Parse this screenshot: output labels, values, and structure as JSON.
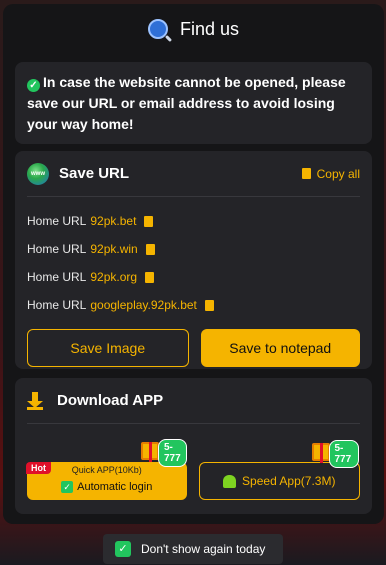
{
  "header": {
    "title": "Find us"
  },
  "notice": {
    "text": "In case the website cannot be opened, please save our URL or email address to avoid losing your way home!"
  },
  "save_url": {
    "title": "Save URL",
    "copy_all": "Copy all",
    "prefix": "Home URL",
    "urls": [
      "92pk.bet",
      "92pk.win",
      "92pk.org",
      "googleplay.92pk.bet"
    ],
    "save_image": "Save Image",
    "save_notepad": "Save to notepad"
  },
  "download": {
    "title": "Download APP",
    "hot": "Hot",
    "quick_line1": "Quick APP(10Kb)",
    "quick_line2": "Automatic login",
    "badge_quick": "5-777",
    "speed_label": "Speed App(7.3M)",
    "badge_speed": "5-777"
  },
  "footer": {
    "dont_show": "Don't show again today"
  },
  "colors": {
    "accent": "#f5b400",
    "success": "#22c55e",
    "hot": "#e0102a"
  }
}
